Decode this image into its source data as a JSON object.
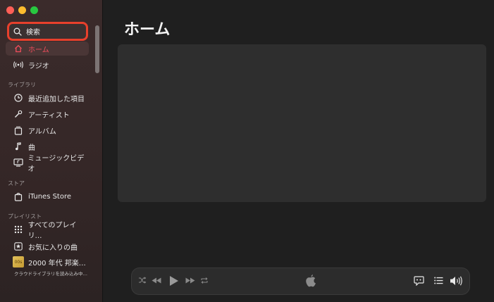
{
  "sidebar": {
    "search_label": "検索",
    "primary_items": [
      {
        "label": "ホーム",
        "icon": "home-icon",
        "active": true
      },
      {
        "label": "ラジオ",
        "icon": "radio-icon",
        "active": false
      }
    ],
    "library_header": "ライブラリ",
    "library_items": [
      {
        "label": "最近追加した項目",
        "icon": "clock-icon"
      },
      {
        "label": "アーティスト",
        "icon": "microphone-icon"
      },
      {
        "label": "アルバム",
        "icon": "album-icon"
      },
      {
        "label": "曲",
        "icon": "music-note-icon"
      },
      {
        "label": "ミュージックビデオ",
        "icon": "music-video-icon"
      }
    ],
    "store_header": "ストア",
    "store_items": [
      {
        "label": "iTunes Store",
        "icon": "store-icon"
      }
    ],
    "playlist_header": "プレイリスト",
    "playlist_items": [
      {
        "label": "すべてのプレイリ…",
        "icon": "grid-icon"
      },
      {
        "label": "お気に入りの曲",
        "icon": "star-icon"
      },
      {
        "label": "2000 年代 邦楽…",
        "icon": "playlist-artwork-icon",
        "artwork_text": "00s"
      }
    ],
    "status_text": "クラウドライブラリを読み込み中…"
  },
  "main": {
    "title": "ホーム"
  },
  "player": {
    "controls": [
      "shuffle-icon",
      "rewind-icon",
      "play-icon",
      "fast-forward-icon",
      "repeat-icon",
      "apple-logo-icon",
      "lyrics-icon",
      "queue-list-icon",
      "volume-icon"
    ]
  },
  "colors": {
    "accent": "#f24d5c",
    "highlight_border": "#e8402c"
  }
}
